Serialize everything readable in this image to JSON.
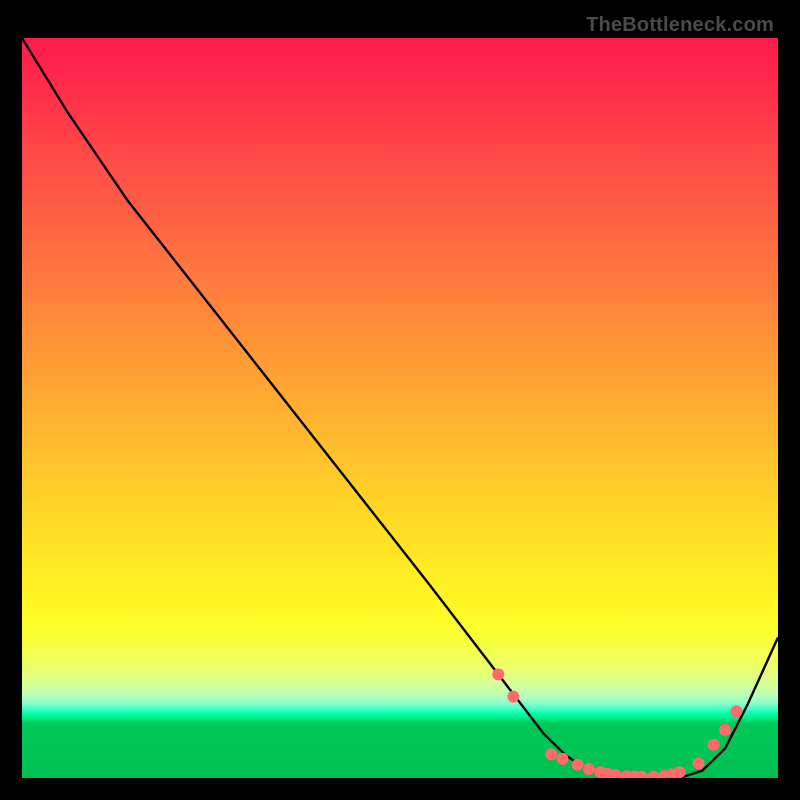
{
  "watermark": "TheBottleneck.com",
  "chart_data": {
    "type": "line",
    "title": "",
    "xlabel": "",
    "ylabel": "",
    "xlim": [
      0,
      100
    ],
    "ylim": [
      0,
      100
    ],
    "series": [
      {
        "name": "curve",
        "x": [
          0,
          6,
          14,
          24,
          34,
          44,
          54,
          63,
          69,
          72,
          75,
          79,
          83,
          87,
          90,
          93,
          96,
          100
        ],
        "y": [
          100,
          90,
          78,
          65,
          52,
          39,
          26,
          14,
          6,
          3,
          1,
          0,
          0,
          0,
          1,
          4,
          10,
          19
        ]
      },
      {
        "name": "markers-left",
        "x": [
          63.0,
          65.0
        ],
        "y": [
          14.0,
          11.0
        ]
      },
      {
        "name": "markers-valley",
        "x": [
          70.0,
          71.5,
          73.5,
          75.0,
          76.5,
          77.5,
          78.5,
          80.0,
          81.0,
          82.0,
          83.5,
          85.0,
          86.0,
          87.0
        ],
        "y": [
          3.2,
          2.6,
          1.8,
          1.2,
          0.8,
          0.55,
          0.4,
          0.25,
          0.2,
          0.18,
          0.2,
          0.3,
          0.5,
          0.8
        ]
      },
      {
        "name": "markers-right",
        "x": [
          89.5,
          91.5,
          93.0,
          94.5
        ],
        "y": [
          2.0,
          4.5,
          6.5,
          9.0
        ]
      }
    ],
    "marker_color": "#ff6a6a",
    "line_color": "#000000"
  }
}
